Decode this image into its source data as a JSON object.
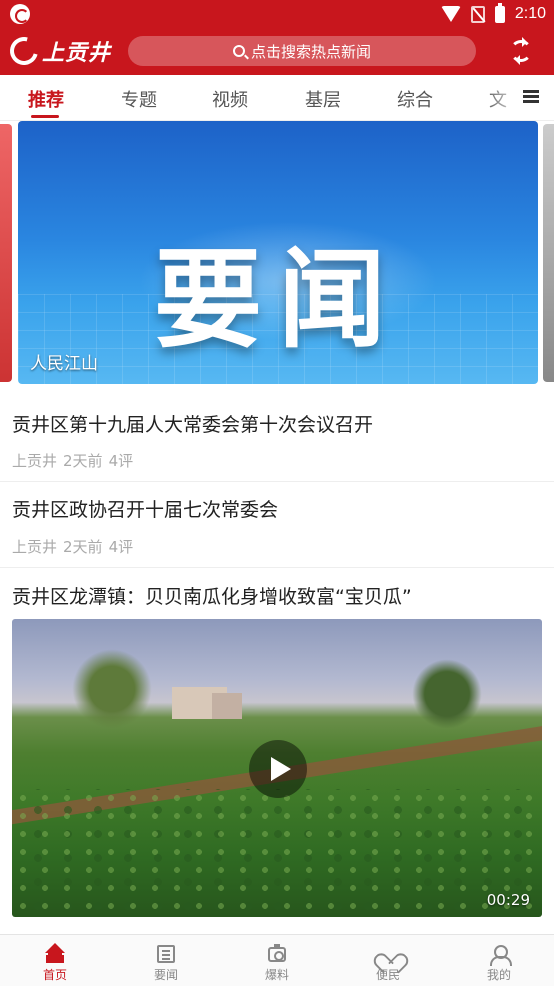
{
  "status_bar": {
    "time": "2:10",
    "icons": [
      "app-notification-icon",
      "wifi-icon",
      "no-sim-icon",
      "battery-icon"
    ]
  },
  "header": {
    "logo_text": "上贡井",
    "search_placeholder": "点击搜索热点新闻",
    "refresh_icon": "refresh-icon",
    "brand_color": "#c8161d"
  },
  "tabs": [
    {
      "label": "推荐",
      "active": true
    },
    {
      "label": "专题",
      "active": false
    },
    {
      "label": "视频",
      "active": false
    },
    {
      "label": "基层",
      "active": false
    },
    {
      "label": "综合",
      "active": false
    },
    {
      "label": "文",
      "active": false
    }
  ],
  "banner": {
    "title": "要闻",
    "caption": "人民江山"
  },
  "news": [
    {
      "title": "贡井区第十九届人大常委会第十次会议召开",
      "source": "上贡井",
      "time": "2天前",
      "comments": "4评"
    },
    {
      "title": "贡井区政协召开十届七次常委会",
      "source": "上贡井",
      "time": "2天前",
      "comments": "4评"
    },
    {
      "title": "贡井区龙潭镇：贝贝南瓜化身增收致富“宝贝瓜”",
      "duration": "00:29"
    }
  ],
  "bottom_nav": [
    {
      "label": "首页",
      "icon": "home-icon",
      "active": true
    },
    {
      "label": "要闻",
      "icon": "newspaper-icon",
      "active": false
    },
    {
      "label": "爆料",
      "icon": "camera-icon",
      "active": false
    },
    {
      "label": "便民",
      "icon": "heart-icon",
      "active": false
    },
    {
      "label": "我的",
      "icon": "user-icon",
      "active": false
    }
  ]
}
